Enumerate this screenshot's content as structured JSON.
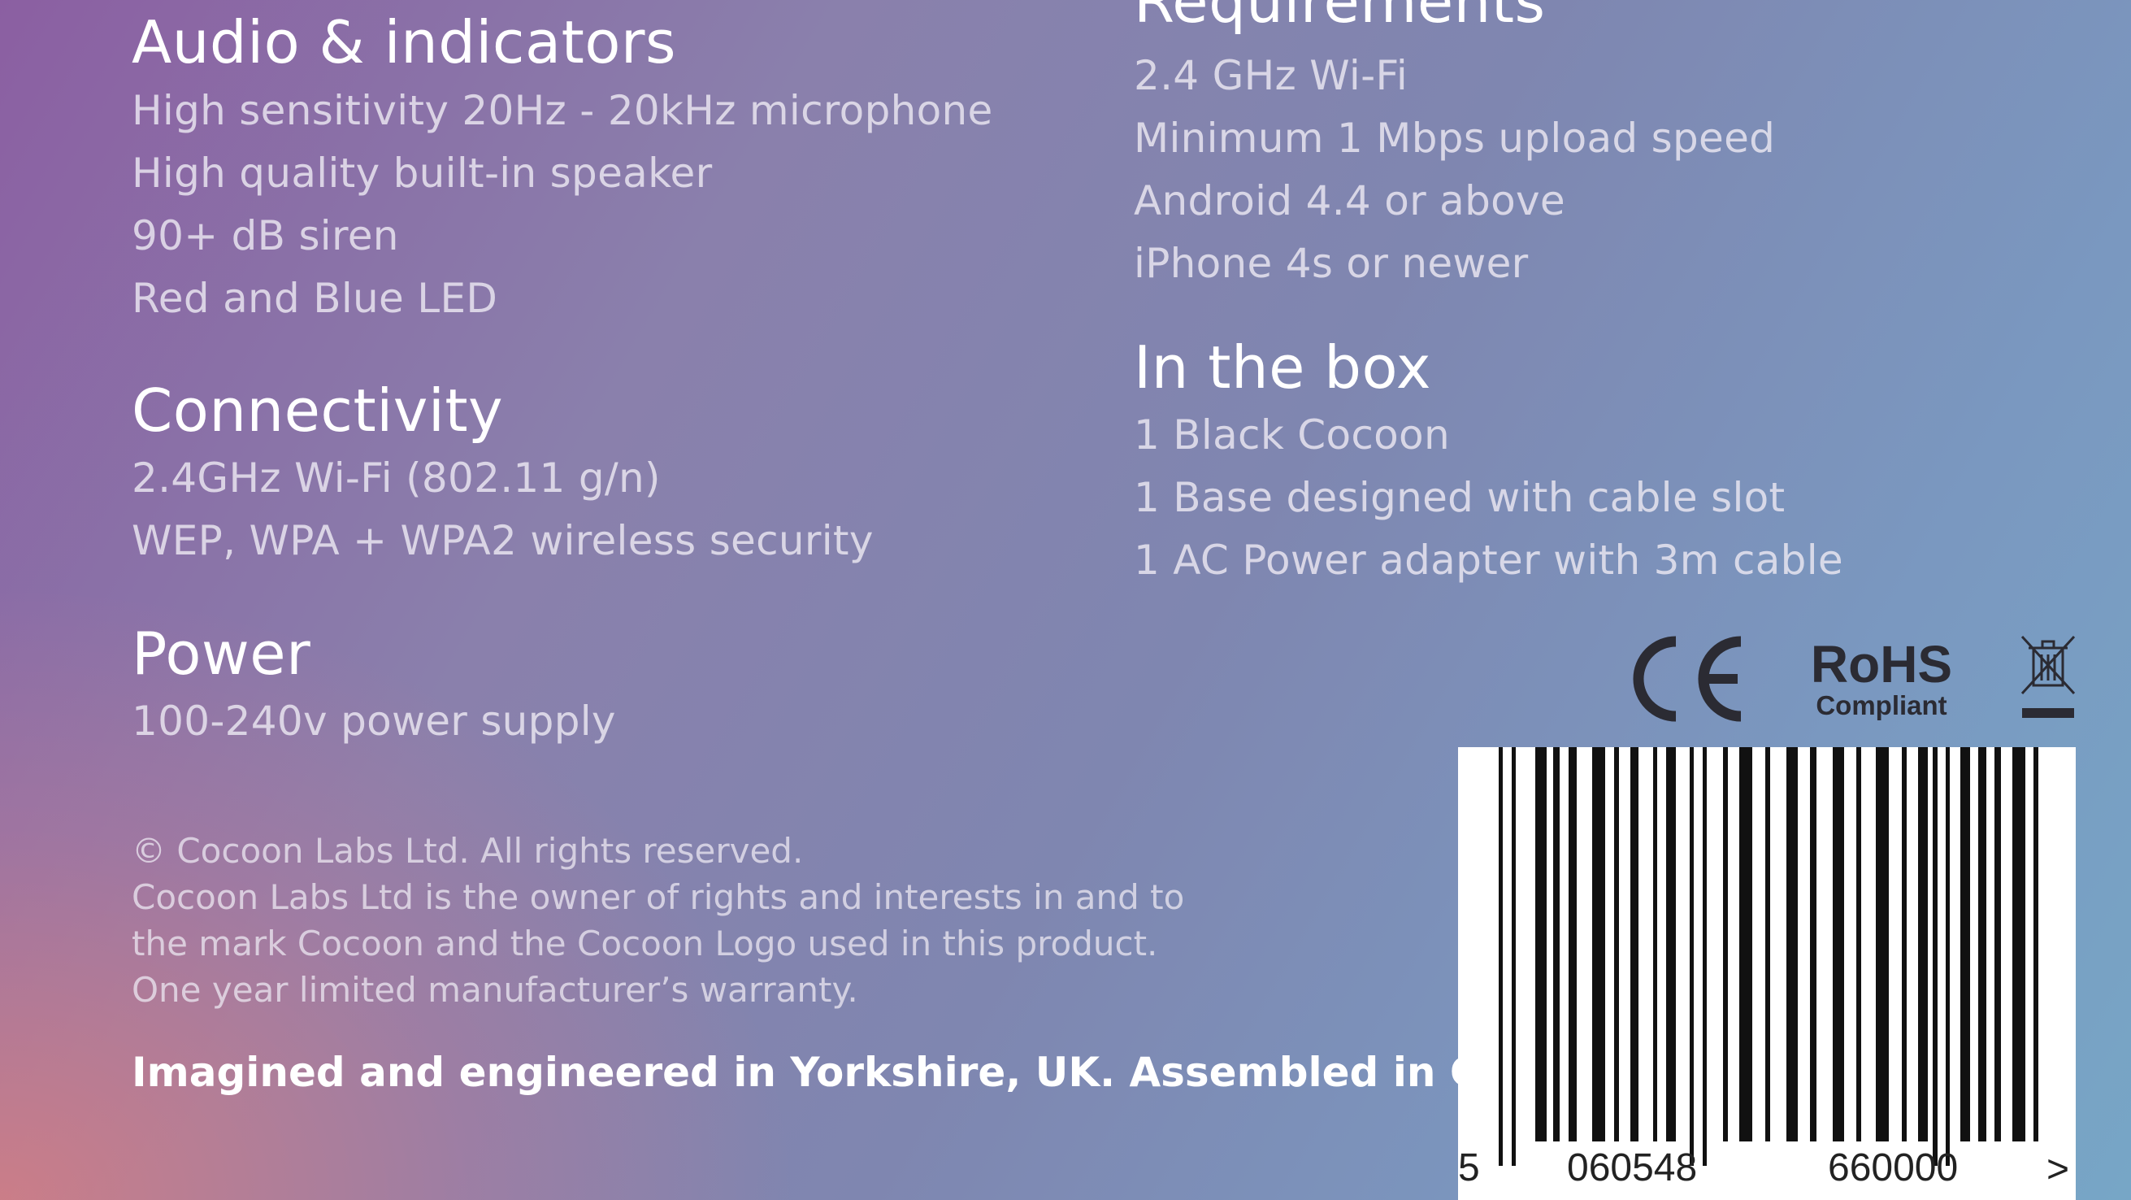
{
  "sections": {
    "audio": {
      "title": "Audio & indicators",
      "items": [
        "High sensitivity 20Hz - 20kHz microphone",
        "High quality built-in speaker",
        "90+ dB siren",
        "Red and Blue LED"
      ]
    },
    "connectivity": {
      "title": "Connectivity",
      "items": [
        "2.4GHz Wi-Fi (802.11 g/n)",
        "WEP, WPA + WPA2 wireless security"
      ]
    },
    "power": {
      "title": "Power",
      "items": [
        "100-240v power supply"
      ]
    },
    "requirements": {
      "title": "Requirements",
      "items": [
        "2.4 GHz Wi-Fi",
        "Minimum 1 Mbps upload speed",
        "Android 4.4 or above",
        "iPhone 4s or newer"
      ]
    },
    "in_the_box": {
      "title": "In the box",
      "items": [
        "1 Black Cocoon",
        "1 Base designed with cable slot",
        "1 AC Power adapter with 3m cable"
      ]
    }
  },
  "legal": [
    "© Cocoon Labs Ltd. All rights reserved.",
    "Cocoon Labs Ltd is the owner of rights and interests in and to",
    "the mark Cocoon and the Cocoon Logo used in this product.",
    "One year limited manufacturer’s warranty."
  ],
  "tagline": "Imagined and engineered in Yorkshire, UK. Assembled in China.",
  "certifications": {
    "ce": "CE",
    "rohs_title": "RoHS",
    "rohs_sub": "Compliant",
    "weee": "weee-crossed-bin-icon"
  },
  "barcode": {
    "first_digit": "5",
    "left_group": "060548",
    "right_group": "660000",
    "marker": ">"
  },
  "colors": {
    "heading": "#ffffff",
    "body_text": "#ece8f2",
    "mark_color": "#2b2b33"
  }
}
